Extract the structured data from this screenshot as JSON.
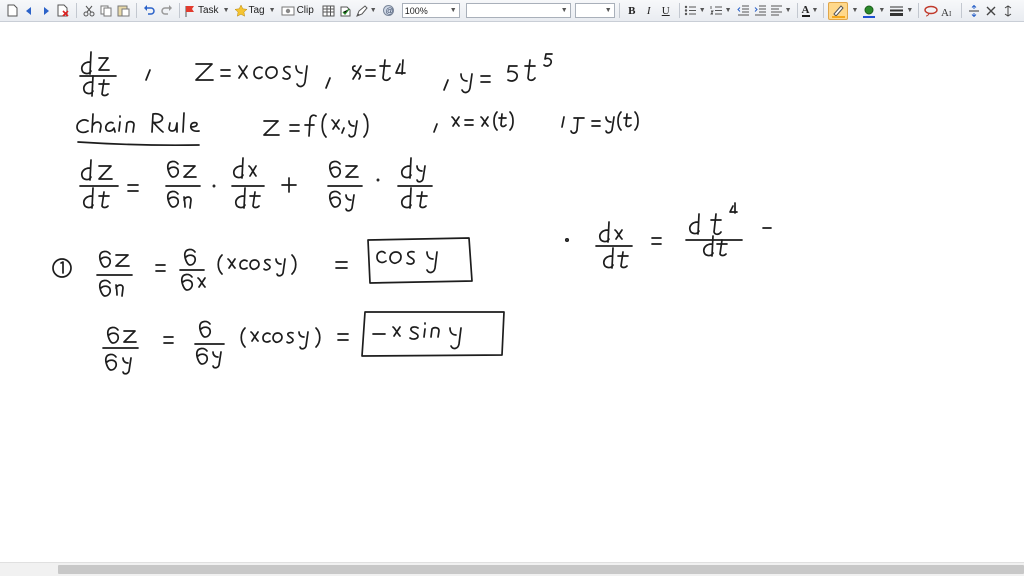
{
  "toolbar": {
    "task_label": "Task",
    "tag_label": "Tag",
    "clip_label": "Clip",
    "zoom_value": "100%",
    "font_name": "",
    "font_size": "",
    "bold_label": "B",
    "italic_label": "I",
    "underline_label": "U",
    "font_color_label": "A",
    "highlight_color": "#f4a81d",
    "pen_color": "#1f4fd1"
  },
  "colors": {
    "ink": "#1d1d1d",
    "toolbar_bg": "#eef0f4",
    "page_bg": "#ffffff",
    "scroll_thumb": "#c8c8c8"
  }
}
